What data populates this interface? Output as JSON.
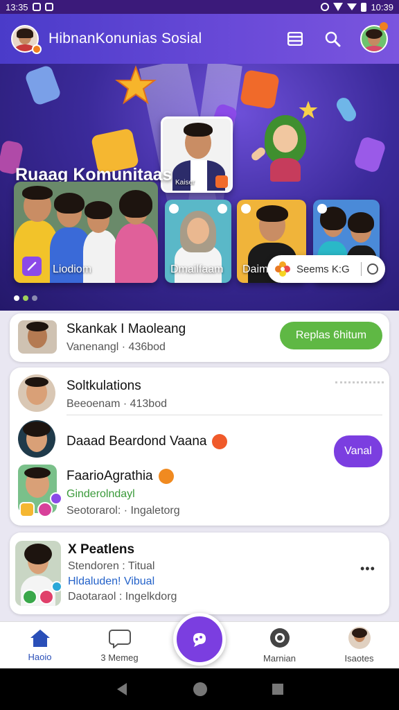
{
  "status_bar": {
    "time_left": "13:35",
    "time_right": "10:39"
  },
  "app_bar": {
    "title": "HibnanKonunias Sosial",
    "actions": [
      "menu-icon",
      "search-icon",
      "profile-avatar"
    ]
  },
  "hero": {
    "title": "Ruaag Komunitaas",
    "cards": [
      {
        "label": "Liodiom"
      },
      {
        "label": "Dmailfaam"
      },
      {
        "label": "Daim"
      }
    ],
    "featured_card_caption": "Kaiser",
    "pill_text": "Seems K:G",
    "carousel_dots": 3
  },
  "request_card": {
    "name": "Skankak I Maoleang",
    "subtitle": "Vanenangl · 436bod",
    "button_label": "Replas 6hitum"
  },
  "list_card": {
    "items": [
      {
        "name": "Soltkulations",
        "subtitle": "Beeoenam · 413bod"
      },
      {
        "name": "Daaad Beardond Vaana",
        "button_label": "Vanal"
      },
      {
        "name": "FaarioAgrathia",
        "subtitle_green": "Ginderolndayl",
        "subtitle": "Seotorarol: · Ingaletorg"
      }
    ]
  },
  "post_card": {
    "name": "X Peatlens",
    "line1": "Stendoren : Titual",
    "line2": "Hldaluden! Vibual",
    "line3": "Daotaraol : Ingelkdorg",
    "more": "•••"
  },
  "bottom_nav": [
    {
      "label": "Haoio",
      "icon": "home-icon"
    },
    {
      "label": "3 Memeg",
      "icon": "chat-icon"
    },
    {
      "label": "Marnian",
      "icon": "camera-icon"
    },
    {
      "label": "Isaotes",
      "icon": "profile-avatar"
    }
  ],
  "colors": {
    "accent": "#6a4ad8",
    "green_button": "#5fb844",
    "purple_button": "#7b3ee0"
  }
}
